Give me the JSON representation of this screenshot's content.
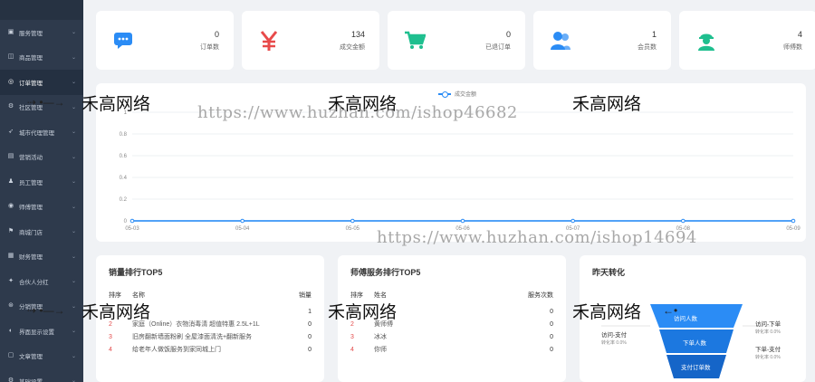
{
  "sidebar": {
    "logo": "",
    "items": [
      {
        "label": "服务管理",
        "icon": "server-icon",
        "glyph": "▣",
        "active": false
      },
      {
        "label": "商品管理",
        "icon": "goods-icon",
        "glyph": "◫",
        "active": false
      },
      {
        "label": "订单管理",
        "icon": "order-icon",
        "glyph": "◎",
        "active": true
      },
      {
        "label": "社区管理",
        "icon": "community-icon",
        "glyph": "⚙",
        "active": false
      },
      {
        "label": "城市代理管理",
        "icon": "agent-icon",
        "glyph": "➶",
        "active": false
      },
      {
        "label": "营销活动",
        "icon": "marketing-icon",
        "glyph": "▤",
        "active": false
      },
      {
        "label": "员工管理",
        "icon": "staff-icon",
        "glyph": "♟",
        "active": false
      },
      {
        "label": "师傅管理",
        "icon": "master-icon",
        "glyph": "◉",
        "active": false
      },
      {
        "label": "商城门店",
        "icon": "store-icon",
        "glyph": "⚑",
        "active": false
      },
      {
        "label": "财务管理",
        "icon": "finance-icon",
        "glyph": "▦",
        "active": false
      },
      {
        "label": "合伙人分红",
        "icon": "partner-icon",
        "glyph": "✦",
        "active": false
      },
      {
        "label": "分销管理",
        "icon": "distribution-icon",
        "glyph": "⊛",
        "active": false
      },
      {
        "label": "界面显示设置",
        "icon": "display-icon",
        "glyph": "◐",
        "active": false
      },
      {
        "label": "文章管理",
        "icon": "article-icon",
        "glyph": "▢",
        "active": false
      },
      {
        "label": "基础设置",
        "icon": "settings-icon",
        "glyph": "⚙",
        "active": false
      }
    ]
  },
  "stats": [
    {
      "value": "0",
      "label": "订单数",
      "icon": "chat-icon",
      "color": "#2b8cf5"
    },
    {
      "value": "134",
      "label": "成交金额",
      "icon": "yuan-icon",
      "color": "#e84a4a"
    },
    {
      "value": "0",
      "label": "已退订单",
      "icon": "cart-icon",
      "color": "#1fbf8f"
    },
    {
      "value": "1",
      "label": "会员数",
      "icon": "users-icon",
      "color": "#2b8cf5"
    },
    {
      "value": "4",
      "label": "师傅数",
      "icon": "worker-icon",
      "color": "#1fbf8f"
    }
  ],
  "chart_data": {
    "type": "line",
    "legend": [
      "成交金额"
    ],
    "x": [
      "05-03",
      "05-04",
      "05-05",
      "05-06",
      "05-07",
      "05-08",
      "05-09"
    ],
    "series": [
      {
        "name": "成交金额",
        "values": [
          0,
          0,
          0,
          0,
          0,
          0,
          0
        ]
      }
    ],
    "yticks": [
      "0",
      "0.2",
      "0.4",
      "0.6",
      "0.8",
      "1"
    ],
    "ylim": [
      0,
      1
    ],
    "grid": true,
    "color": "#2b8cf5"
  },
  "sales_top": {
    "title": "销量排行TOP5",
    "headers": [
      "排序",
      "名称",
      "销量"
    ],
    "rows": [
      {
        "rank": "1",
        "name": "",
        "value": "1"
      },
      {
        "rank": "2",
        "name": "家庭（Online）衣物消毒清 超值特惠 2.5L+1L",
        "value": "0"
      },
      {
        "rank": "3",
        "name": "旧房翻新墙面粉刷 全屋漆面清洗+翻新服务",
        "value": "0"
      },
      {
        "rank": "4",
        "name": "给老年人做饭服务到家同城上门",
        "value": "0"
      }
    ]
  },
  "master_top": {
    "title": "师傅服务排行TOP5",
    "headers": [
      "排序",
      "姓名",
      "服务次数"
    ],
    "rows": [
      {
        "rank": "1",
        "name": "",
        "value": "0"
      },
      {
        "rank": "2",
        "name": "黄师傅",
        "value": "0"
      },
      {
        "rank": "3",
        "name": "冰冰",
        "value": "0"
      },
      {
        "rank": "4",
        "name": "你师",
        "value": "0"
      }
    ]
  },
  "conversion": {
    "title": "昨天转化",
    "top_label": "访问人数",
    "mid_label": "下单人数",
    "bottom_label": "支付订单数",
    "left_label": "访问-支付",
    "left_rate": "转化率 0.0%",
    "right1_label": "访问-下单",
    "right1_rate": "转化率 0.0%",
    "right2_label": "下单-支付",
    "right2_rate": "转化率 0.0%"
  },
  "watermarks": {
    "brand": "禾高网络",
    "url1": "https://www.huzhan.com/ishop46682",
    "url2": "https://www.huzhan.com/ishop14694"
  }
}
